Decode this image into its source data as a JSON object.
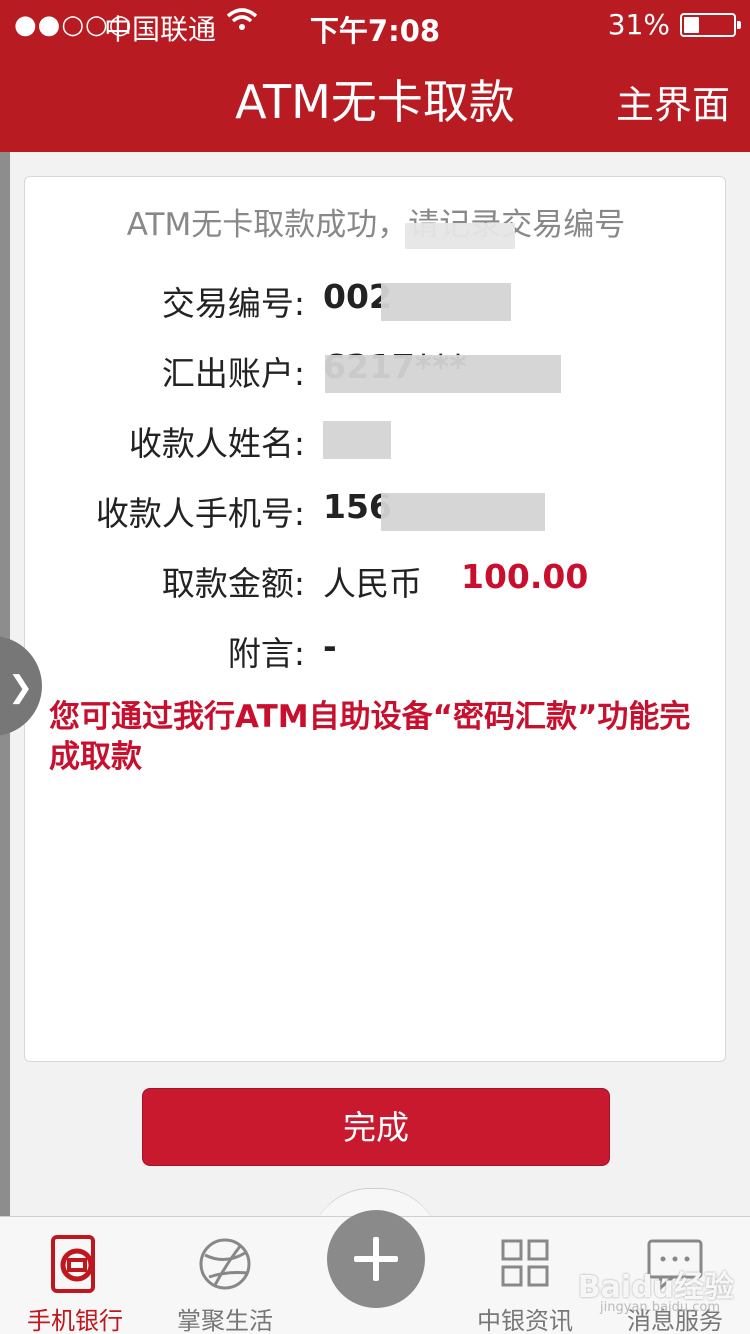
{
  "status_bar": {
    "signal": "●●○○○",
    "carrier": "中国联通",
    "time": "下午7:08",
    "battery": "31%",
    "battery_level": 0.31
  },
  "nav": {
    "title": "ATM无卡取款",
    "right_button": "主界面"
  },
  "result": {
    "header": "ATM无卡取款成功，请记录交易编号",
    "rows": [
      {
        "label": "交易编号:",
        "value": "002"
      },
      {
        "label": "汇出账户:",
        "value": "6217***"
      },
      {
        "label": "收款人姓名:",
        "value": ""
      },
      {
        "label": "收款人手机号:",
        "value": "156"
      },
      {
        "label": "取款金额:",
        "value": "人民币",
        "amount": "100.00"
      },
      {
        "label": "附言:",
        "value": "-"
      }
    ],
    "note": "您可通过我行ATM自助设备“密码汇款”功能完成取款"
  },
  "done_button": "完成",
  "tabbar": {
    "tabs": [
      {
        "label": "手机银行",
        "icon": "boc-phone-icon",
        "active": true
      },
      {
        "label": "掌聚生活",
        "icon": "globe-icon",
        "active": false
      },
      {
        "label": "中银资讯",
        "icon": "grid-icon",
        "active": false
      },
      {
        "label": "消息服务",
        "icon": "message-icon",
        "active": false
      }
    ],
    "center_icon": "plus-icon"
  },
  "watermark": {
    "text": "Baidu经验",
    "sub": "jingyan.baidu.com"
  },
  "colors": {
    "brand_red": "#b81c22",
    "accent_red": "#c8102e"
  }
}
